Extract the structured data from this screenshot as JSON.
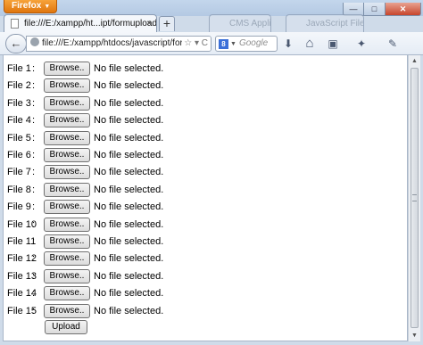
{
  "titlebar": {
    "app_menu_label": "Firefox",
    "minimize_glyph": "—",
    "maximize_glyph": "□",
    "close_glyph": "✕"
  },
  "tabs": {
    "active_title": "file:///E:/xampp/ht...ipt/formupload.html",
    "ghost_titles": [
      "CMS Application",
      "JavaScript File Uplo"
    ],
    "close_glyph": "×",
    "new_tab_glyph": "+"
  },
  "navbar": {
    "back_glyph": "←",
    "url": "file:///E:/xampp/htdocs/javascript/form",
    "url_tail": "☆ ▾ C",
    "search_engine_letter": "8",
    "search_placeholder": "Google",
    "icons": {
      "download": "⬇",
      "home": "⌂",
      "bookmarks": "▣",
      "addon": "✦",
      "tools": "✎"
    }
  },
  "form": {
    "rows": [
      {
        "label": "File 1"
      },
      {
        "label": "File 2"
      },
      {
        "label": "File 3"
      },
      {
        "label": "File 4"
      },
      {
        "label": "File 5"
      },
      {
        "label": "File 6"
      },
      {
        "label": "File 7"
      },
      {
        "label": "File 8"
      },
      {
        "label": "File 9"
      },
      {
        "label": "File 10"
      },
      {
        "label": "File 11"
      },
      {
        "label": "File 12"
      },
      {
        "label": "File 13"
      },
      {
        "label": "File 14"
      },
      {
        "label": "File 15"
      }
    ],
    "colon": ":",
    "browse_label": "Browse..",
    "no_file_text": "No file selected.",
    "upload_label": "Upload"
  },
  "scrollbar": {
    "up": "▲",
    "down": "▼"
  }
}
